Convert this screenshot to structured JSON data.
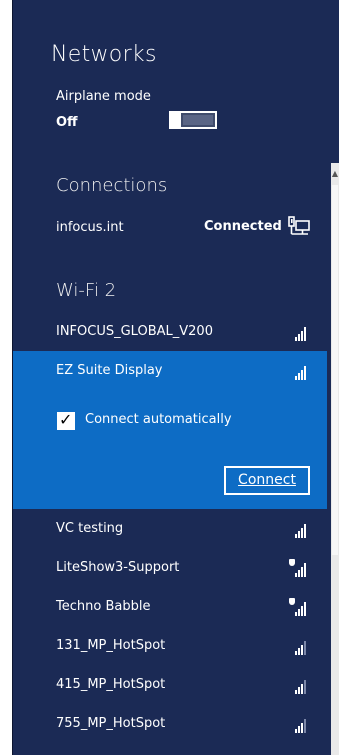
{
  "header": {
    "title": "Networks"
  },
  "airplane": {
    "label": "Airplane mode",
    "state": "Off",
    "on": false
  },
  "connections": {
    "heading": "Connections",
    "items": [
      {
        "name": "infocus.int",
        "status": "Connected",
        "icon": "ethernet-icon"
      }
    ]
  },
  "wifi": {
    "heading": "Wi-Fi 2",
    "networks": [
      {
        "name": "INFOCUS_GLOBAL_V200",
        "signal": 4,
        "secured": false
      },
      {
        "name": "EZ Suite Display",
        "signal": 4,
        "secured": false,
        "selected": true
      },
      {
        "name": "VC testing",
        "signal": 4,
        "secured": false
      },
      {
        "name": "LiteShow3-Support",
        "signal": 4,
        "secured": true
      },
      {
        "name": "Techno Babble",
        "signal": 4,
        "secured": true
      },
      {
        "name": "131_MP_HotSpot",
        "signal": 3,
        "secured": false
      },
      {
        "name": "415_MP_HotSpot",
        "signal": 3,
        "secured": false
      },
      {
        "name": "755_MP_HotSpot",
        "signal": 3,
        "secured": false
      }
    ],
    "selected_panel": {
      "auto_label": "Connect automatically",
      "auto_checked": true,
      "connect_label": "Connect"
    }
  },
  "colors": {
    "panel_bg": "#1b2a55",
    "selected_bg": "#0d6cc5",
    "text": "#ffffff"
  }
}
